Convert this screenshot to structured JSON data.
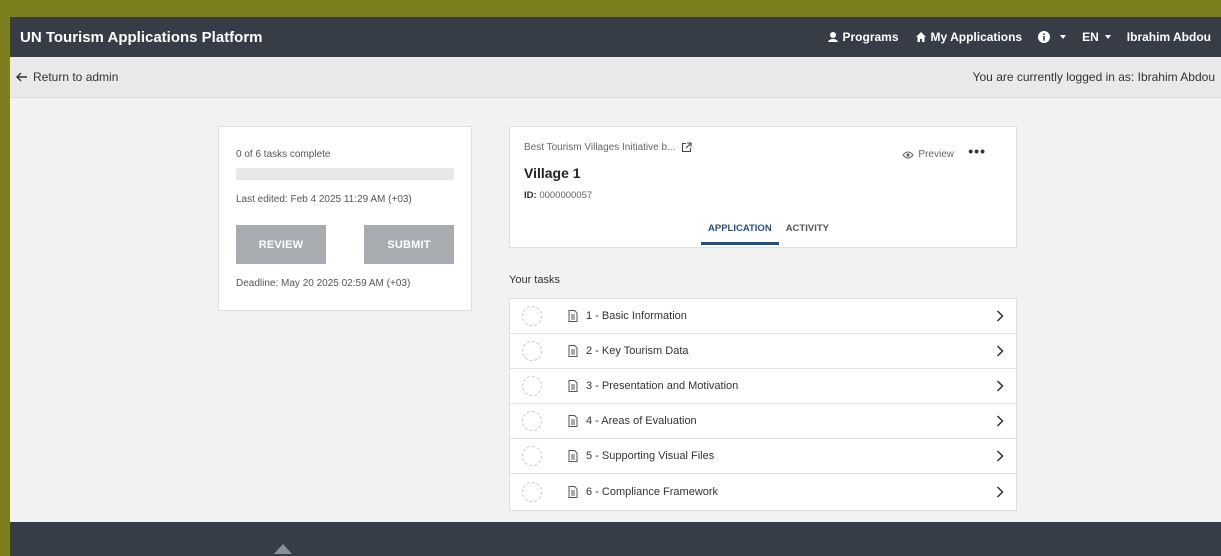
{
  "header": {
    "brand": "UN Tourism Applications Platform",
    "nav": {
      "programs": "Programs",
      "my_applications": "My Applications",
      "language": "EN",
      "user": "Ibrahim Abdou"
    }
  },
  "subbar": {
    "back_label": "Return to admin",
    "login_text": "You are currently logged in as: Ibrahim Abdou"
  },
  "progress_card": {
    "tasks_complete": "0 of 6 tasks complete",
    "progress_fraction": 0,
    "last_edited": "Last edited: Feb 4 2025 11:29 AM (+03)",
    "review_label": "REVIEW",
    "submit_label": "SUBMIT",
    "deadline": "Deadline: May 20 2025 02:59 AM (+03)"
  },
  "application": {
    "program": "Best Tourism Villages Initiative b...",
    "title": "Village 1",
    "id_label": "ID:",
    "id_value": "0000000057",
    "preview_label": "Preview",
    "more_label": "•••",
    "tabs": [
      {
        "label": "APPLICATION",
        "active": true
      },
      {
        "label": "ACTIVITY",
        "active": false
      }
    ]
  },
  "tasks": {
    "heading": "Your tasks",
    "items": [
      {
        "label": "1 - Basic Information"
      },
      {
        "label": "2 - Key Tourism Data"
      },
      {
        "label": "3 - Presentation and Motivation"
      },
      {
        "label": "4 - Areas of Evaluation"
      },
      {
        "label": "5 - Supporting Visual Files"
      },
      {
        "label": "6 - Compliance Framework"
      }
    ]
  }
}
